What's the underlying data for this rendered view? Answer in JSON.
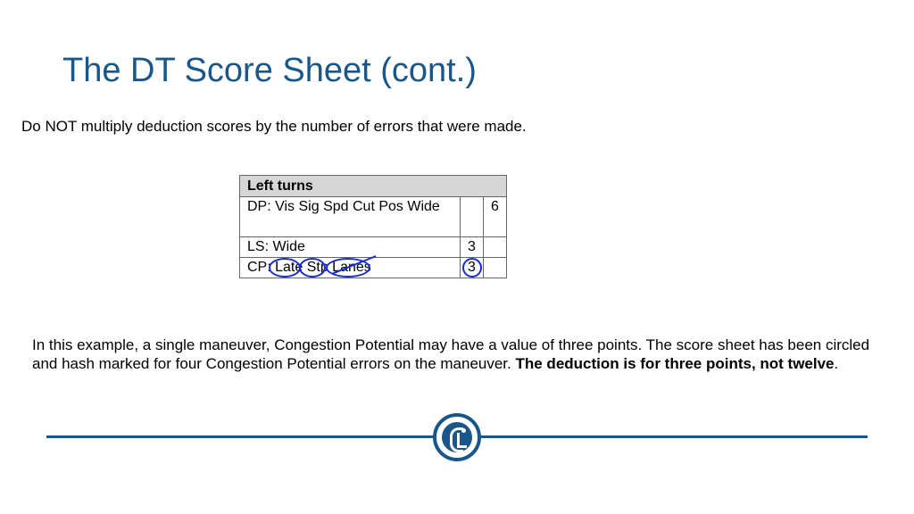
{
  "title": "The DT Score Sheet (cont.)",
  "intro": "Do NOT multiply deduction scores by the number of errors that were made.",
  "sheet": {
    "header": "Left turns",
    "rows": [
      {
        "label": "DP: Vis  Sig  Spd  Cut  Pos  Wide",
        "mid": "",
        "right": "6"
      },
      {
        "label": "LS: Wide",
        "mid": "3",
        "right": ""
      },
      {
        "label": "CP: Late  Stp  Lanes",
        "mid": "3",
        "right": ""
      }
    ]
  },
  "explain_plain": "In this example, a single maneuver, Congestion Potential may have a value of three points. The score sheet has been circled and hash marked for four Congestion Potential errors on the maneuver. ",
  "explain_bold": "The deduction is for three points, not twelve",
  "period": "."
}
